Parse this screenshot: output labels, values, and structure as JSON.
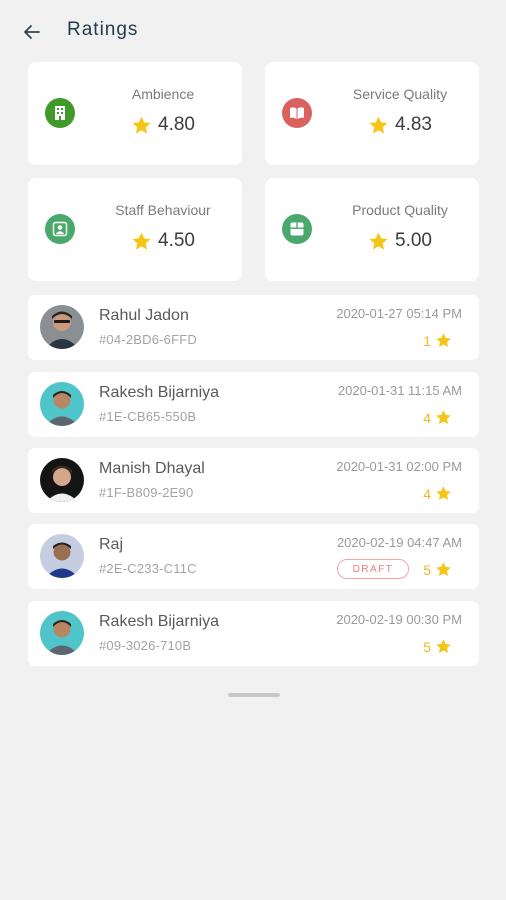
{
  "header": {
    "title": "Ratings",
    "back_icon": "arrow-left-icon"
  },
  "categories": [
    {
      "name": "Ambience",
      "score": "4.80",
      "icon": "building-icon",
      "icon_color": "#3f9a2b"
    },
    {
      "name": "Service Quality",
      "score": "4.83",
      "icon": "book-icon",
      "icon_color": "#d9625f"
    },
    {
      "name": "Staff Behaviour",
      "score": "4.50",
      "icon": "user-badge-icon",
      "icon_color": "#4ba86c"
    },
    {
      "name": "Product Quality",
      "score": "5.00",
      "icon": "box-icon",
      "icon_color": "#4ba86c"
    }
  ],
  "ratings": [
    {
      "name": "Rahul Jadon",
      "code": "#04-2BD6-6FFD",
      "timestamp": "2020-01-27 05:14 PM",
      "stars": "1",
      "draft": ""
    },
    {
      "name": "Rakesh Bijarniya",
      "code": "#1E-CB65-550B",
      "timestamp": "2020-01-31 11:15 AM",
      "stars": "4",
      "draft": ""
    },
    {
      "name": "Manish Dhayal",
      "code": "#1F-B809-2E90",
      "timestamp": "2020-01-31 02:00 PM",
      "stars": "4",
      "draft": ""
    },
    {
      "name": "Raj",
      "code": "#2E-C233-C11C",
      "timestamp": "2020-02-19 04:47 AM",
      "stars": "5",
      "draft": "DRAFT"
    },
    {
      "name": "Rakesh Bijarniya",
      "code": "#09-3026-710B",
      "timestamp": "2020-02-19 00:30 PM",
      "stars": "5",
      "draft": ""
    }
  ],
  "colors": {
    "star": "#f5c518",
    "background": "#f1f1f2",
    "draft": "#ee7a85"
  }
}
